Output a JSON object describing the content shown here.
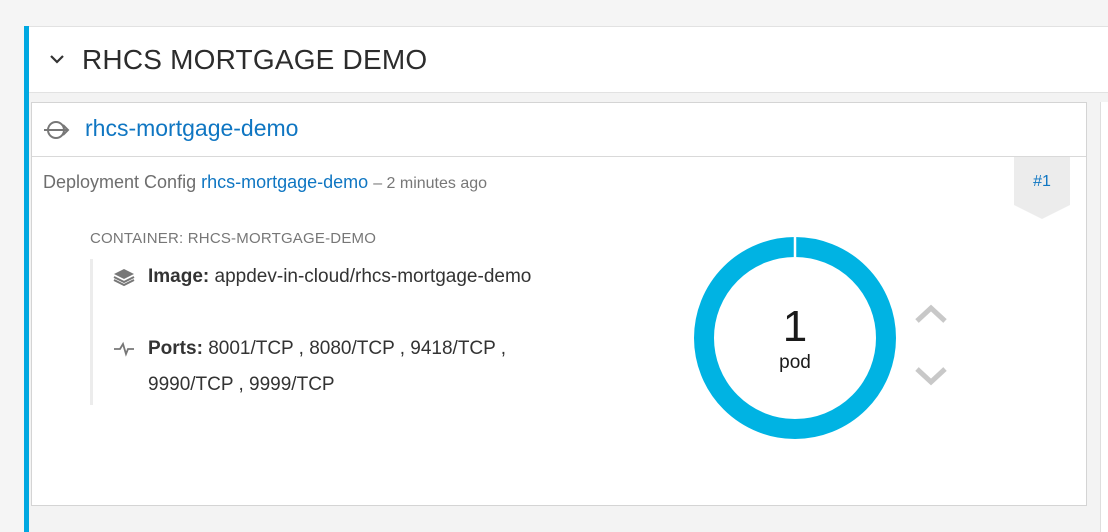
{
  "app": {
    "title": "RHCS MORTGAGE DEMO",
    "accent_color": "#00a8e1"
  },
  "service": {
    "icon": "service-icon",
    "name": "rhcs-mortgage-demo"
  },
  "deployment": {
    "prefix": "Deployment Config",
    "config_name": "rhcs-mortgage-demo",
    "time": "– 2 minutes ago",
    "version": "#1"
  },
  "container": {
    "label": "CONTAINER: RHCS-MORTGAGE-DEMO",
    "image_key": "Image:",
    "image_value": "appdev-in-cloud/rhcs-mortgage-demo",
    "ports_key": "Ports:",
    "ports_value": "8001/TCP , 8080/TCP , 9418/TCP , 9990/TCP , 9999/TCP"
  },
  "pods": {
    "count": "1",
    "label": "pod",
    "ring_color": "#00b3e3"
  }
}
